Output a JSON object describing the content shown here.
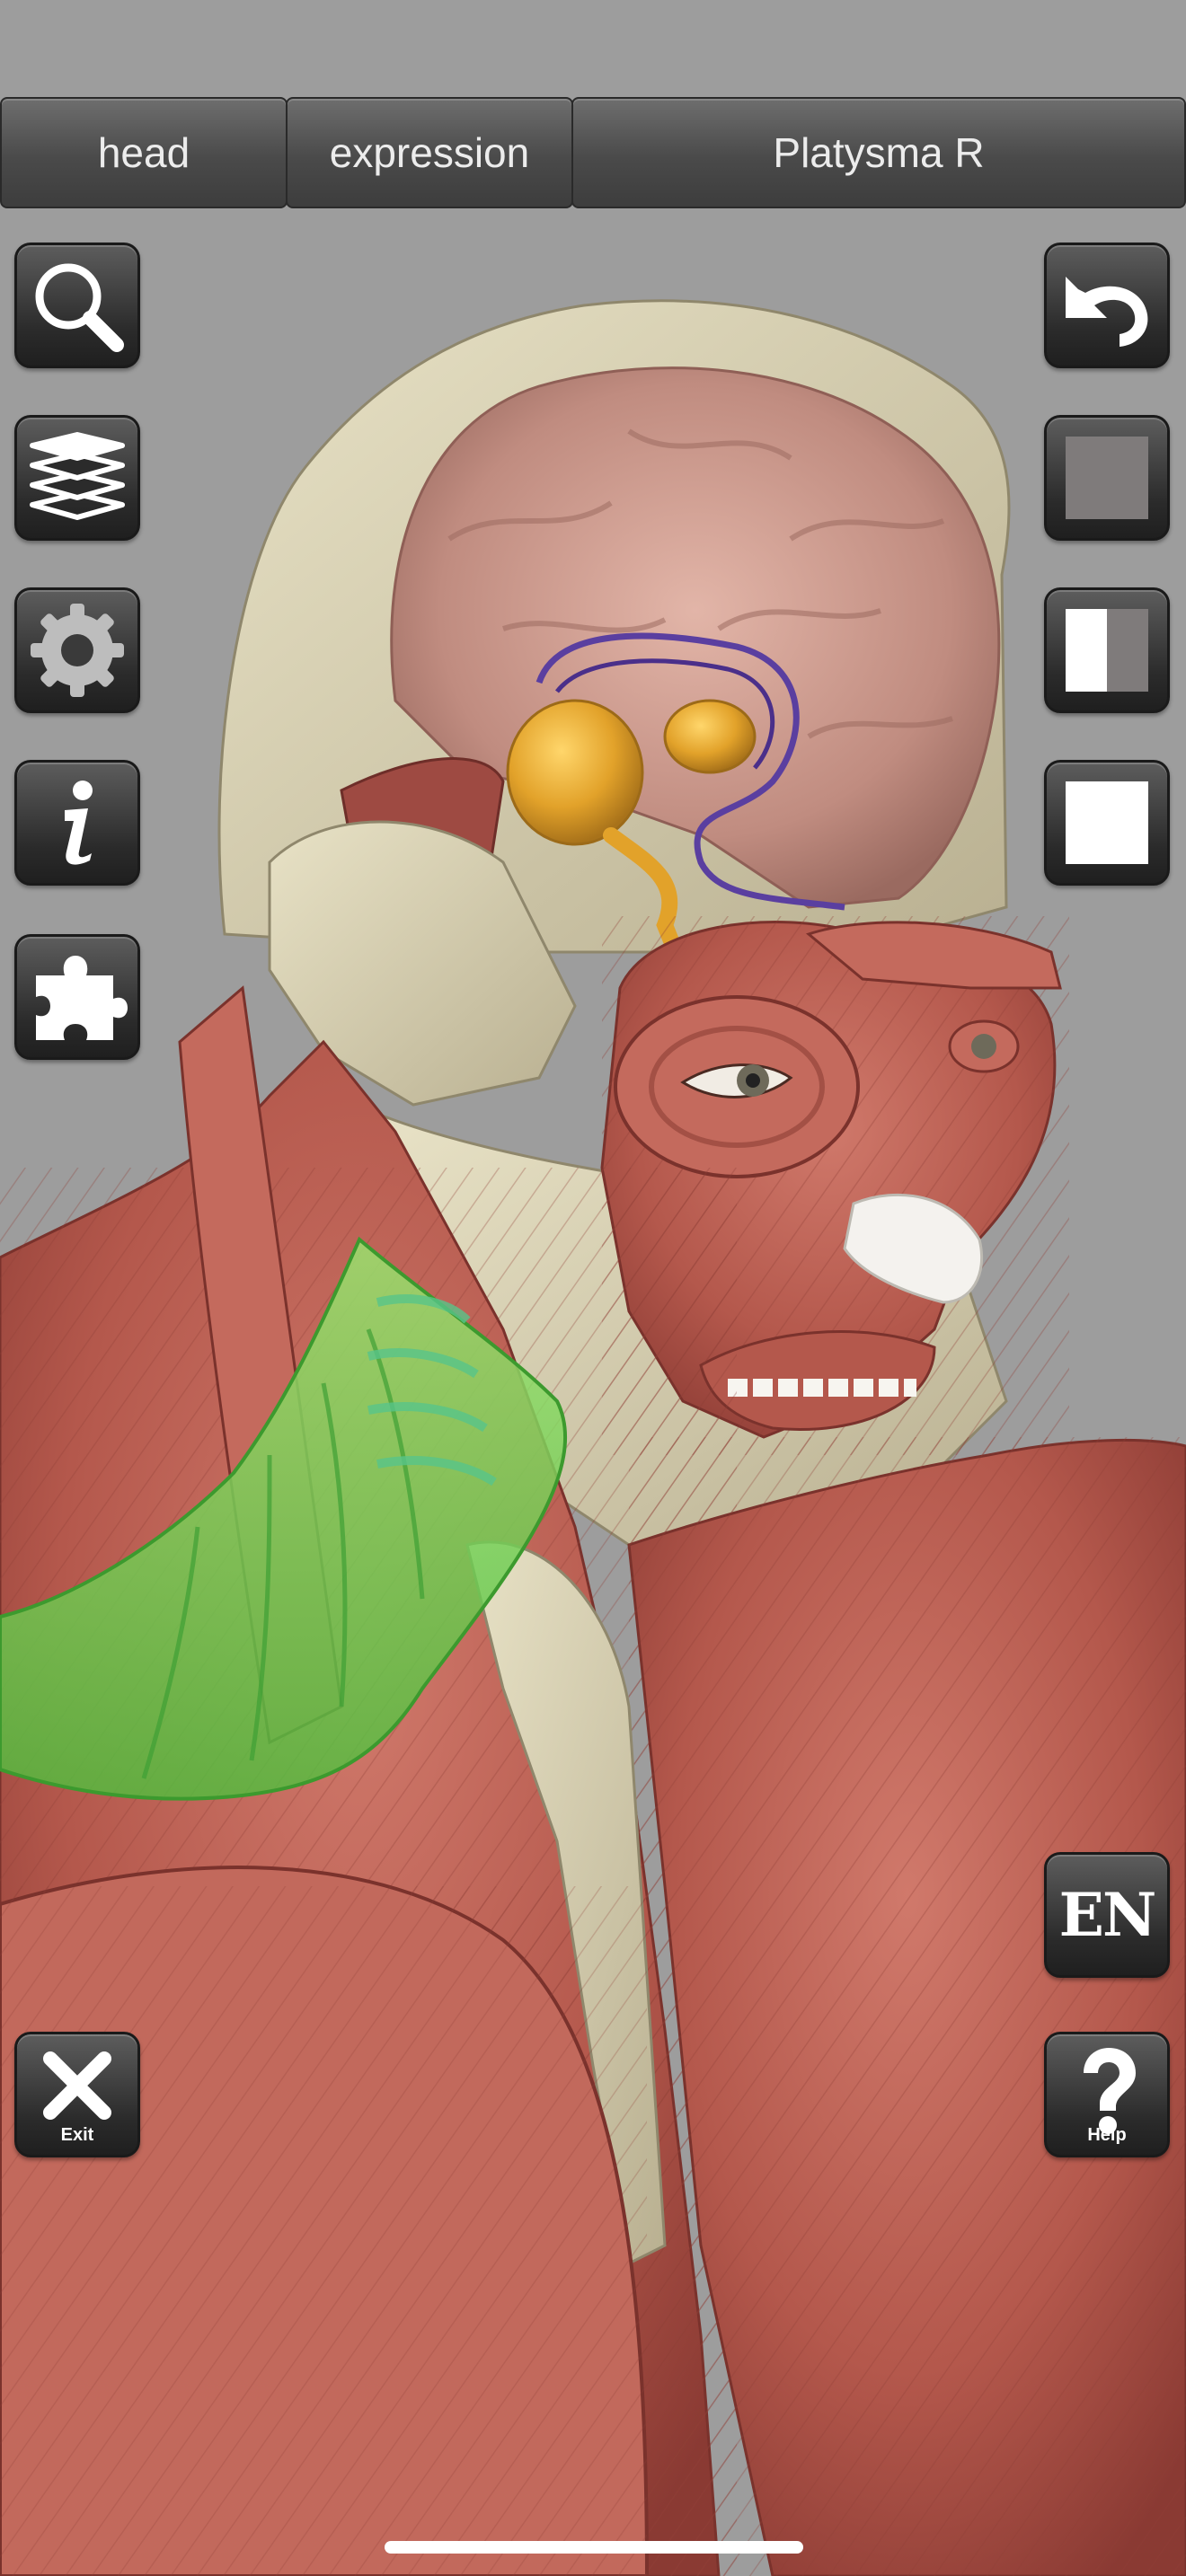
{
  "breadcrumb": {
    "items": [
      {
        "label": "head"
      },
      {
        "label": "expression"
      },
      {
        "label": "Platysma R"
      }
    ]
  },
  "left_toolbar": {
    "items": [
      {
        "icon": "search-icon"
      },
      {
        "icon": "layers-icon"
      },
      {
        "icon": "gear-icon"
      },
      {
        "icon": "info-icon"
      },
      {
        "icon": "puzzle-icon"
      }
    ],
    "exit_label": "Exit"
  },
  "right_toolbar": {
    "items": [
      {
        "icon": "undo-icon"
      },
      {
        "icon": "opacity-gray-icon"
      },
      {
        "icon": "opacity-half-icon"
      },
      {
        "icon": "opacity-white-icon"
      }
    ],
    "language_label": "EN",
    "help_label": "Help"
  },
  "colors": {
    "background": "#9d9d9d",
    "muscle": "#b85a4e",
    "bone": "#d9d1b0",
    "brain": "#c99a8e",
    "selected_highlight": "#6fd05a",
    "nerve": "#e6a72d",
    "vessel": "#5a3fa0"
  }
}
